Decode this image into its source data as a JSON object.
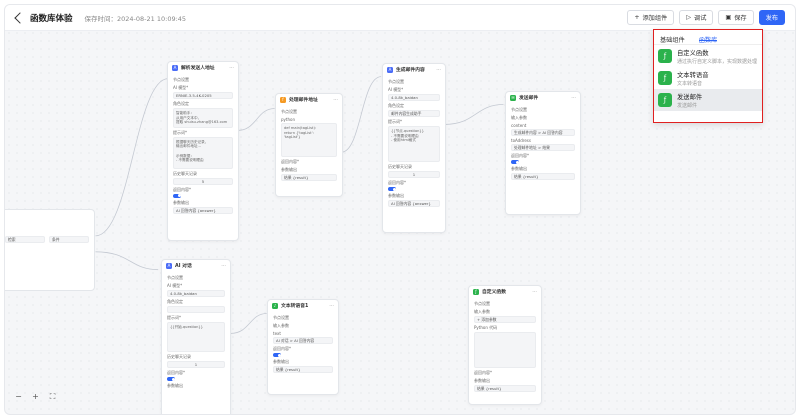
{
  "header": {
    "title": "函数库体验",
    "saved_time": "保存时间：2024-08-21 10:09:45",
    "add_component": "添加组件",
    "debug": "调试",
    "save": "保存",
    "publish": "发布"
  },
  "dropdown": {
    "tabs": [
      "基础组件",
      "函数库"
    ],
    "items": [
      {
        "title": "自定义函数",
        "sub": "通过执行自定义脚本，实现数据处理"
      },
      {
        "title": "文本转语音",
        "sub": "文本转语音"
      },
      {
        "title": "发送邮件",
        "sub": "发送邮件"
      }
    ]
  },
  "nodes": {
    "n1": {
      "title": "解析发送人地址",
      "s1": "节点设置",
      "model_label": "AI 模型*",
      "model_link": "参数设置",
      "model": "ERNIE-3.5-4K-0205",
      "role_label": "角色设定",
      "role": "智能助手：\n从用户文本中，\n提取 shuisu.zhang@163.com",
      "prompt_label": "提示词*",
      "prompt": "根据聊天历史记录，\n输出邮件地址...\n\n示例数据：\n- 不需要说明理由",
      "history_label": "历史聊天记录",
      "history": "5",
      "output_label": "返回内容*",
      "param": "参数输出",
      "out": "AI 回答内容 {answer}"
    },
    "n2": {
      "title": "处理邮件地址",
      "s1": "节点设置",
      "lang_label": "python",
      "code": "def main(tagList):\n  return {'tagList':\n  'tagList'}",
      "output_label": "返回内容*",
      "param": "参数输出",
      "out": "结果 {result}"
    },
    "n3": {
      "title": "生成邮件内容",
      "s1": "节点设置",
      "model_label": "AI 模型*",
      "model": "4.0-8k_baidan",
      "role_label": "角色设定",
      "role": "邮件内容生成助手",
      "prompt_label": "提示词*",
      "prompt": "{{节点.question}}\n- 不需要说明理由\n- 使用html格式",
      "history_label": "历史聊天记录",
      "history": "1",
      "output_label": "返回内容*",
      "param": "参数输出",
      "out": "AI 回答内容 {answer}"
    },
    "n4": {
      "title": "发送邮件",
      "s1": "节点设置",
      "in_label": "输入参数",
      "p1": "content",
      "p1v": "生成邮件内容 > AI 回答内容",
      "p2": "toAddress",
      "p2v": "处理邮件地址 > 结果",
      "output_label": "返回内容*",
      "param": "参数输出",
      "out": "结果 {result}"
    },
    "n5": {
      "title": "AI 对话",
      "s1": "节点设置",
      "model_label": "AI 模型*",
      "model_link": "参数设置",
      "model": "4.0-8k_baidan",
      "role_label": "角色设定",
      "prompt_label": "提示词*",
      "prompt": "{{开始.question}}",
      "history_label": "历史聊天记录",
      "history": "1",
      "output_label": "返回内容*",
      "param": "参数输出"
    },
    "n6": {
      "title": "文本转语音1",
      "s1": "节点设置",
      "in_label": "输入参数",
      "p1": "text",
      "p1v": "AI 对话 > AI 回答内容",
      "output_label": "返回内容*",
      "param": "参数输出",
      "out": "结果 {result}"
    },
    "n7": {
      "title": "自定义函数",
      "s1": "节点设置",
      "in_label": "输入参数",
      "add": "+ 添加参数",
      "code_label": "Python 代码",
      "output_label": "返回内容*",
      "param": "参数输出",
      "out": "结果 {result}"
    },
    "n8": {
      "h1": "检索",
      "h2": "条件"
    }
  },
  "zoom": {
    "out": "−",
    "in": "+",
    "fit": "⛶"
  }
}
